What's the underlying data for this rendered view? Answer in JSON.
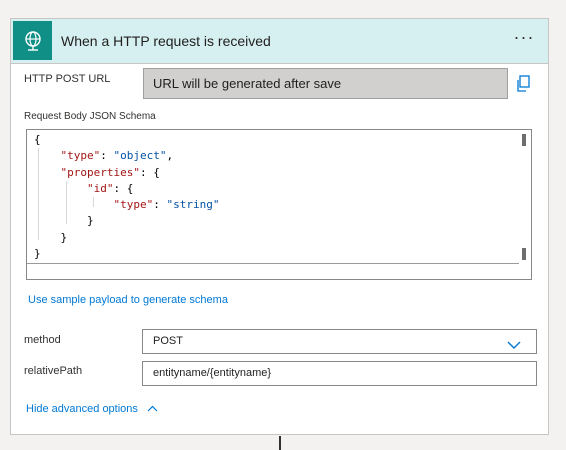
{
  "card": {
    "title": "When a HTTP request is received",
    "more_label": "···",
    "icon": "globe-icon",
    "accent_color": "#0f8f86",
    "header_bg": "#d6eff1"
  },
  "http_url": {
    "label": "HTTP POST URL",
    "value": "URL will be generated after save",
    "copy_icon": "copy-icon"
  },
  "schema": {
    "label": "Request Body JSON Schema",
    "json": "{\n    \"type\": \"object\",\n    \"properties\": {\n        \"id\": {\n            \"type\": \"string\"\n        }\n    }\n}"
  },
  "sample_link": "Use sample payload to generate schema",
  "method": {
    "label": "method",
    "value": "POST"
  },
  "relative_path": {
    "label": "relativePath",
    "value": "entityname/{entityname}"
  },
  "advanced": {
    "label": "Hide advanced options"
  }
}
